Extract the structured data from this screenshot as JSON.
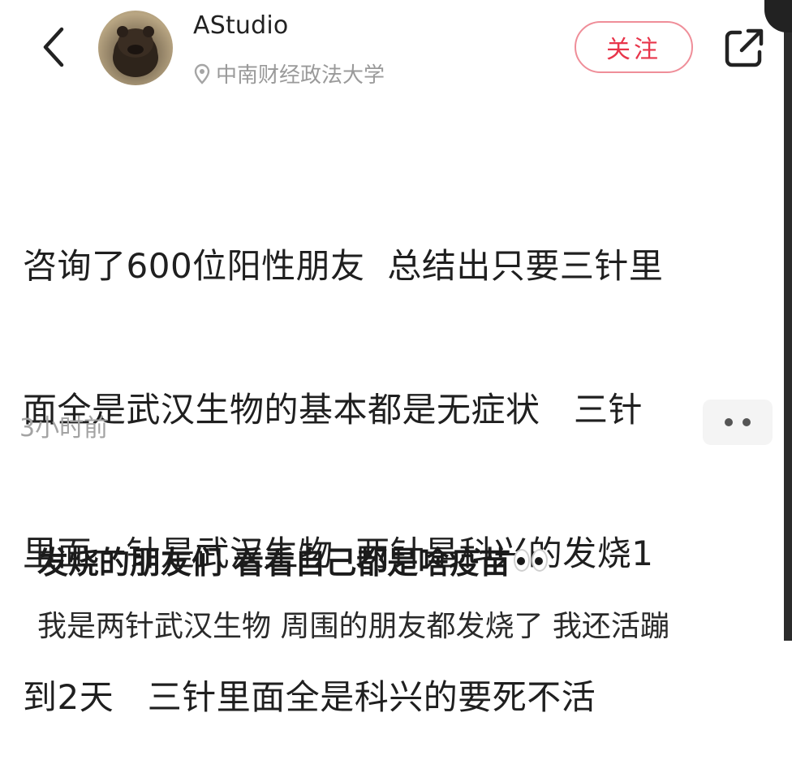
{
  "header": {
    "username": "AStudio",
    "location": "中南财经政法大学",
    "follow_label": "关注",
    "icons": {
      "back": "chevron-left-icon",
      "location": "map-pin-icon",
      "share": "share-external-icon",
      "more": "more-dots-icon"
    }
  },
  "post": {
    "lines": [
      "咨询了600位阳性朋友  总结出只要三针里",
      "面全是武汉生物的基本都是无症状   三针",
      "里面一针是武汉生物  两针是科兴的发烧1",
      "到2天   三针里面全是科兴的要死不活"
    ],
    "time": "3小时前"
  },
  "next_post": {
    "title": "发烧的朋友们 看看自己都是啥疫苗",
    "title_emoji": "eyes-emoji",
    "body": "我是两针武汉生物 周围的朋友都发烧了 我还活蹦"
  },
  "colors": {
    "follow_text": "#e8354b",
    "follow_border": "#ef8e99",
    "secondary_text": "#9a9a9a"
  }
}
